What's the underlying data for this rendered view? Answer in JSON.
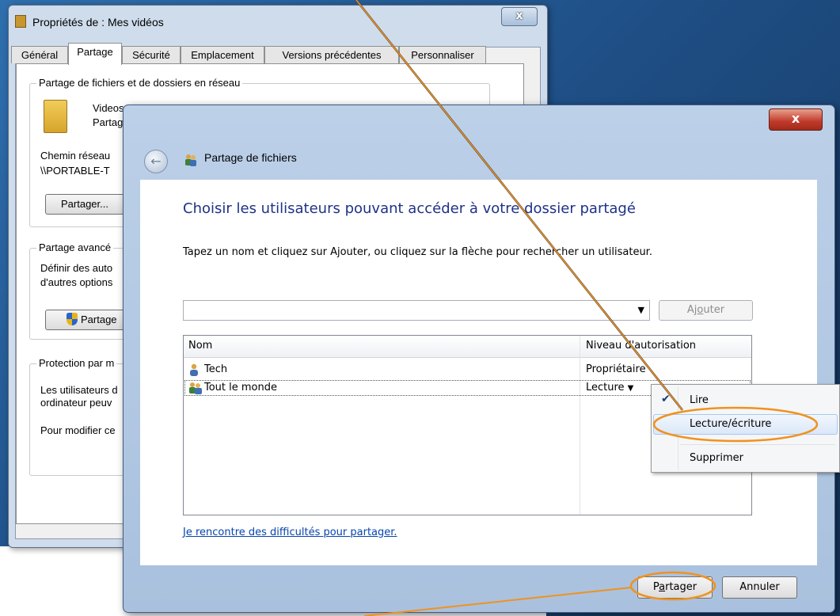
{
  "properties_window": {
    "title": "Propriétés de : Mes vidéos",
    "close_label": "x",
    "tabs": [
      {
        "label": "Général"
      },
      {
        "label": "Partage"
      },
      {
        "label": "Sécurité"
      },
      {
        "label": "Emplacement"
      },
      {
        "label": "Versions précédentes"
      },
      {
        "label": "Personnaliser"
      }
    ],
    "network_group_label": "Partage de fichiers et de dossiers en réseau",
    "folder_name": "Videos",
    "folder_status": "Partag",
    "network_path_label": "Chemin réseau",
    "network_path_value": "\\\\PORTABLE-T",
    "share_button": "Partager...",
    "advanced_group_label": "Partage avancé",
    "advanced_text_1": "Définir des auto",
    "advanced_text_2": "d'autres options",
    "advanced_button": "Partage",
    "protection_group_label": "Protection par m",
    "protection_text_1": "Les utilisateurs d",
    "protection_text_2": "ordinateur peuv",
    "protection_text_3": "Pour modifier ce"
  },
  "share_dialog": {
    "close_label": "x",
    "title": "Partage de fichiers",
    "heading": "Choisir les utilisateurs pouvant accéder à votre dossier partagé",
    "instruction": "Tapez un nom et cliquez sur Ajouter, ou cliquez sur la flèche pour rechercher un utilisateur.",
    "user_input_value": "",
    "add_button_pre": "Aj",
    "add_button_ul": "o",
    "add_button_post": "uter",
    "columns": {
      "name": "Nom",
      "level": "Niveau d'autorisation"
    },
    "rows": [
      {
        "name": "Tech",
        "level": "Propriétaire"
      },
      {
        "name": "Tout le monde",
        "level": "Lecture"
      }
    ],
    "help_link": "Je rencontre des difficultés pour partager.",
    "share_button_pre": "P",
    "share_button_ul": "a",
    "share_button_post": "rtager",
    "cancel_button": "Annuler"
  },
  "permission_menu": {
    "items": [
      {
        "label": "Lire",
        "checked": true
      },
      {
        "label": "Lecture/écriture",
        "highlighted": true
      },
      {
        "label": "Supprimer"
      }
    ]
  },
  "annotation_color": "#f0921e"
}
